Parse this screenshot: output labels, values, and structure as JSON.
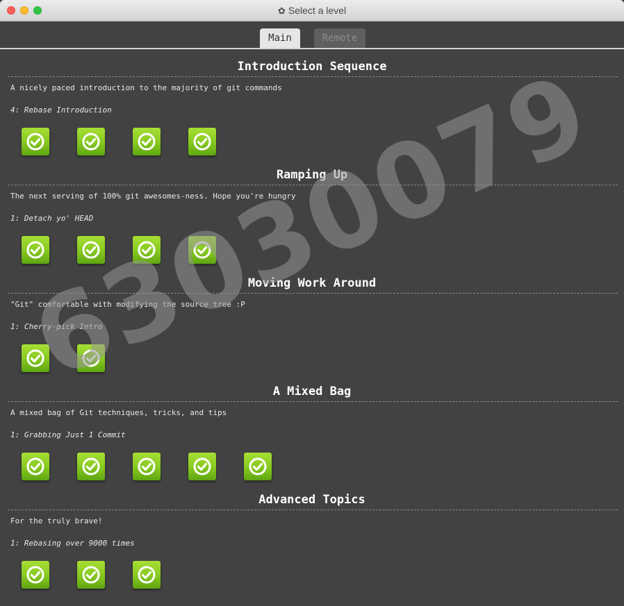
{
  "window": {
    "title": "Select a level",
    "title_icon": "gear-icon"
  },
  "tabs": [
    {
      "label": "Main",
      "active": true
    },
    {
      "label": "Remote",
      "active": false
    }
  ],
  "sections": [
    {
      "title": "Introduction Sequence",
      "description": "A nicely paced introduction to the majority of git commands",
      "current": "4: Rebase Introduction",
      "levels_completed": 4
    },
    {
      "title": "Ramping Up",
      "description": "The next serving of 100% git awesomes-ness. Hope you're hungry",
      "current": "1: Detach yo' HEAD",
      "levels_completed": 4
    },
    {
      "title": "Moving Work Around",
      "description": "\"Git\" comfortable with modifying the source tree :P",
      "current": "1: Cherry-pick Intro",
      "levels_completed": 2
    },
    {
      "title": "A Mixed Bag",
      "description": "A mixed bag of Git techniques, tricks, and tips",
      "current": "1: Grabbing Just 1 Commit",
      "levels_completed": 5
    },
    {
      "title": "Advanced Topics",
      "description": "For the truly brave!",
      "current": "1: Rebasing over 9000 times",
      "levels_completed": 3
    }
  ],
  "watermark": "63030079",
  "colors": {
    "completed": "#86c820",
    "background": "#424242"
  }
}
